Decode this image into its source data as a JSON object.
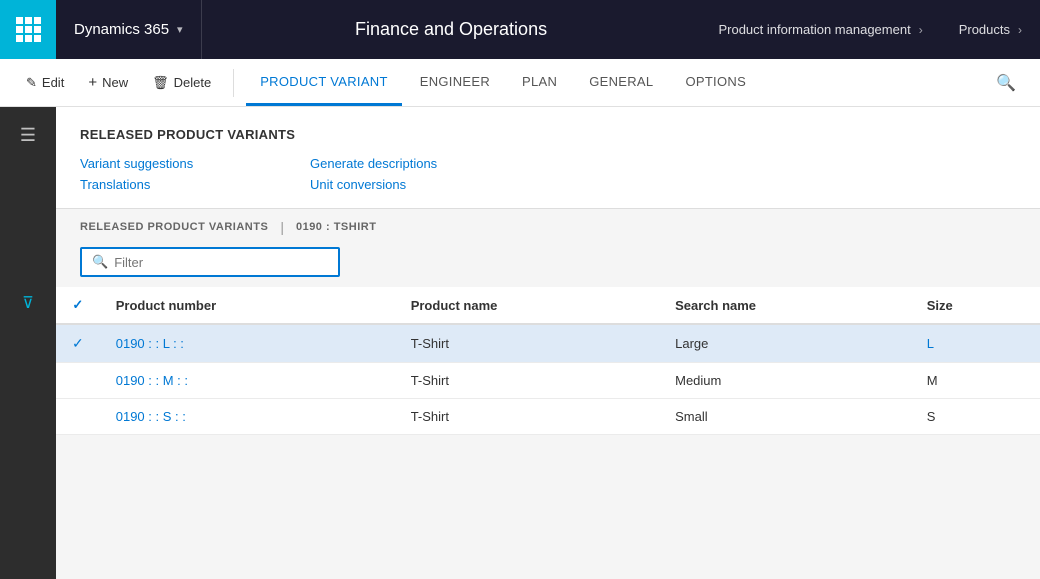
{
  "topNav": {
    "appLauncher": "app-launcher",
    "dynamics365": "Dynamics 365",
    "financeOps": "Finance and Operations",
    "productInfoMgmt": "Product information management",
    "products": "Products"
  },
  "toolbar": {
    "editLabel": "Edit",
    "newLabel": "New",
    "deleteLabel": "Delete",
    "tabs": [
      {
        "id": "product-variant",
        "label": "PRODUCT VARIANT",
        "active": true
      },
      {
        "id": "engineer",
        "label": "ENGINEER",
        "active": false
      },
      {
        "id": "plan",
        "label": "PLAN",
        "active": false
      },
      {
        "id": "general",
        "label": "GENERAL",
        "active": false
      },
      {
        "id": "options",
        "label": "OPTIONS",
        "active": false
      }
    ]
  },
  "releasedProductVariants": {
    "title": "RELEASED PRODUCT VARIANTS",
    "links": [
      {
        "id": "variant-suggestions",
        "label": "Variant suggestions"
      },
      {
        "id": "generate-descriptions",
        "label": "Generate descriptions"
      },
      {
        "id": "translations",
        "label": "Translations"
      },
      {
        "id": "unit-conversions",
        "label": "Unit conversions"
      }
    ]
  },
  "grid": {
    "breadcrumb1": "RELEASED PRODUCT VARIANTS",
    "breadcrumbSep": "|",
    "breadcrumb2": "0190 : TSHIRT",
    "filterPlaceholder": "Filter",
    "columns": [
      {
        "id": "check",
        "label": ""
      },
      {
        "id": "product-number",
        "label": "Product number"
      },
      {
        "id": "product-name",
        "label": "Product name"
      },
      {
        "id": "search-name",
        "label": "Search name"
      },
      {
        "id": "size",
        "label": "Size"
      }
    ],
    "rows": [
      {
        "productNumber": "0190 : : L : :",
        "productName": "T-Shirt",
        "searchName": "Large",
        "size": "L",
        "selected": true
      },
      {
        "productNumber": "0190 : : M : :",
        "productName": "T-Shirt",
        "searchName": "Medium",
        "size": "M",
        "selected": false
      },
      {
        "productNumber": "0190 : : S : :",
        "productName": "T-Shirt",
        "searchName": "Small",
        "size": "S",
        "selected": false
      }
    ]
  }
}
